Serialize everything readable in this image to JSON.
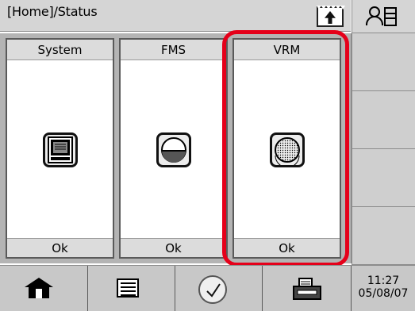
{
  "header": {
    "title": "[Home]/Status"
  },
  "panels": [
    {
      "title": "System",
      "status": "Ok",
      "icon": "system-icon"
    },
    {
      "title": "FMS",
      "status": "Ok",
      "icon": "fms-icon"
    },
    {
      "title": "VRM",
      "status": "Ok",
      "icon": "vrm-icon"
    }
  ],
  "toolbar": {
    "time": "11:27",
    "date": "05/08/07"
  },
  "colors": {
    "highlight": "#e5001a",
    "header_bg": "#d5d5d5",
    "panel_bg": "#b4b4b4",
    "toolbar_bg": "#c8c8c8"
  }
}
